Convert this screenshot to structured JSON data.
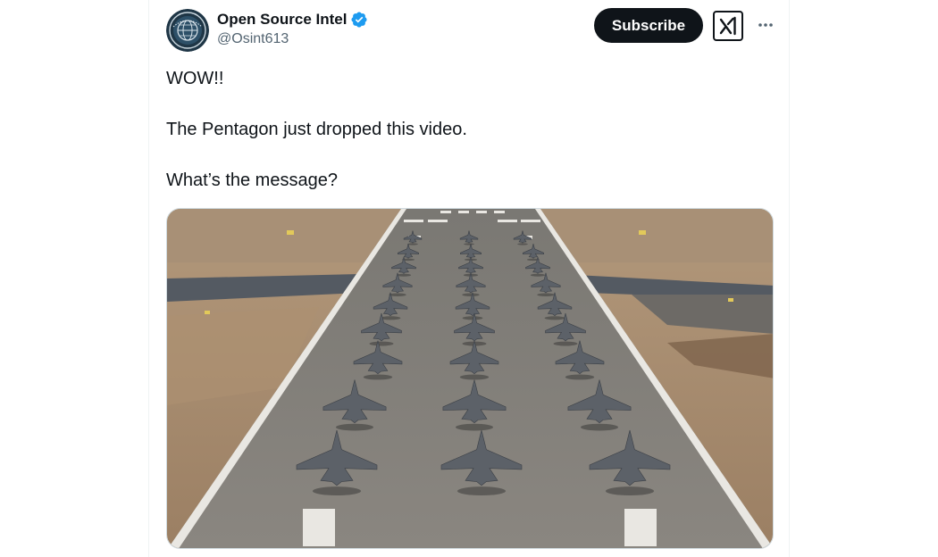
{
  "author": {
    "display_name": "Open Source Intel",
    "handle": "@Osint613",
    "avatar_icon": "globe-crest-icon",
    "verified_icon": "verified-badge-icon",
    "verified_color": "#1d9bf0"
  },
  "actions": {
    "subscribe_label": "Subscribe",
    "grok_icon": "grok-icon",
    "more_icon": "more-options-icon"
  },
  "tweet": {
    "lines": [
      "WOW!!",
      "The Pentagon just dropped this video.",
      "What’s the message?"
    ]
  },
  "media": {
    "type": "video",
    "subject": "fighter-jets-on-runway"
  },
  "colors": {
    "text_primary": "#0f1419",
    "text_secondary": "#536471",
    "button_dark": "#0f1419",
    "accent_blue": "#1d9bf0"
  }
}
